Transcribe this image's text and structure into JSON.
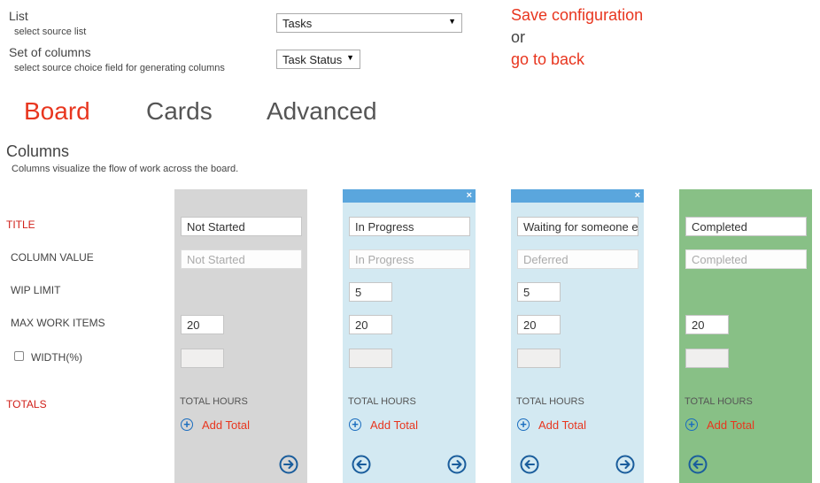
{
  "config": {
    "list_label": "List",
    "list_hint": "select source list",
    "list_value": "Tasks",
    "columns_label": "Set of columns",
    "columns_hint": "select source choice field for generating columns",
    "columns_value": "Task Status",
    "save_link": "Save configuration",
    "or_text": "or",
    "back_link": "go to back"
  },
  "tabs": [
    {
      "label": "Board",
      "active": true
    },
    {
      "label": "Cards",
      "active": false
    },
    {
      "label": "Advanced",
      "active": false
    }
  ],
  "section": {
    "title": "Columns",
    "description": "Columns visualize the flow of work across the board."
  },
  "row_labels": {
    "title": "TITLE",
    "column_value": "COLUMN VALUE",
    "wip_limit": "WIP LIMIT",
    "max_work_items": "MAX WORK ITEMS",
    "width": "WIDTH(%)",
    "totals": "TOTALS"
  },
  "columns": [
    {
      "title": "Not Started",
      "column_value": "Not Started",
      "wip_limit": "",
      "max_work_items": "20",
      "total_hours": "TOTAL HOURS",
      "add_total": "Add Total",
      "close": "",
      "bg": "#d6d6d6"
    },
    {
      "title": "In Progress",
      "column_value": "In Progress",
      "wip_limit": "5",
      "max_work_items": "20",
      "total_hours": "TOTAL HOURS",
      "add_total": "Add Total",
      "close": "×",
      "bg": "#d3e9f2"
    },
    {
      "title": "Waiting for someone e",
      "column_value": "Deferred",
      "wip_limit": "5",
      "max_work_items": "20",
      "total_hours": "TOTAL HOURS",
      "add_total": "Add Total",
      "close": "×",
      "bg": "#d3e9f2"
    },
    {
      "title": "Completed",
      "column_value": "Completed",
      "wip_limit": "",
      "max_work_items": "20",
      "total_hours": "TOTAL HOURS",
      "add_total": "Add Total",
      "close": "",
      "bg": "#88c086"
    }
  ],
  "icons": {
    "arrow_right": "arrow-right-circle-icon",
    "arrow_left": "arrow-left-circle-icon",
    "plus": "plus-circle-icon"
  },
  "colors": {
    "accent_red": "#e8361f",
    "header_blue": "#5aa6dd",
    "nav_blue": "#1a5d9c"
  }
}
